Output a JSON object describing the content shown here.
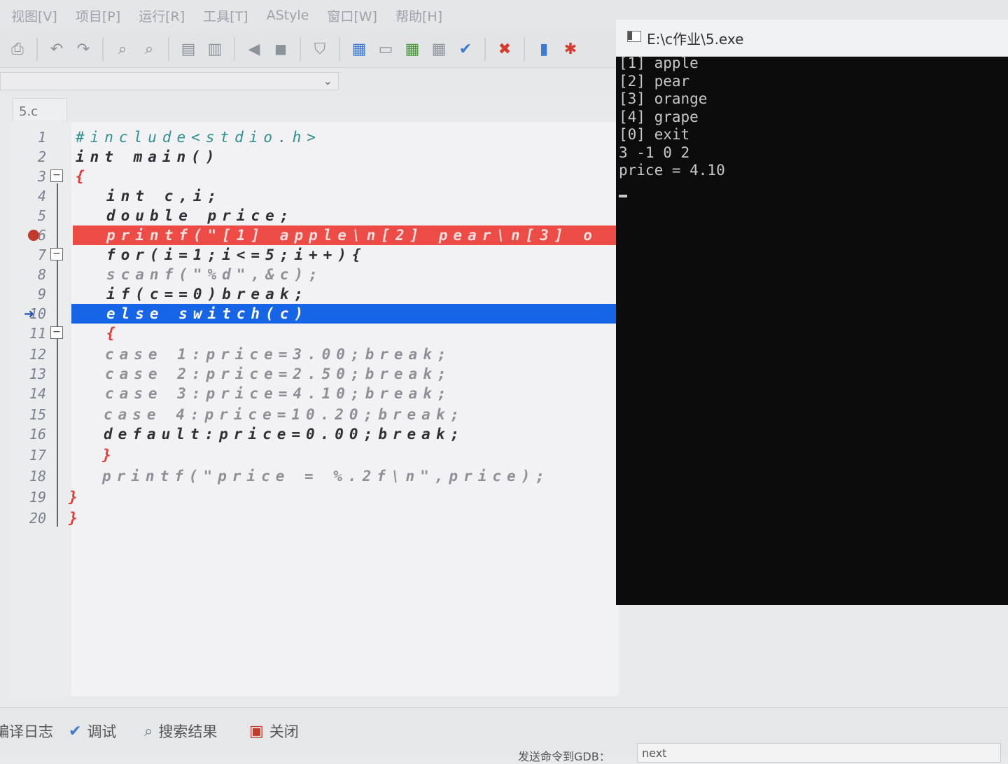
{
  "menu": [
    "视图[V]",
    "项目[P]",
    "运行[R]",
    "工具[T]",
    "AStyle",
    "窗口[W]",
    "帮助[H]"
  ],
  "editor": {
    "tab": "5.c",
    "lines": [
      {
        "n": "1",
        "text": "#include<stdio.h>"
      },
      {
        "n": "2",
        "text": "int main()"
      },
      {
        "n": "3",
        "text": "{"
      },
      {
        "n": "4",
        "text": "int c,i;"
      },
      {
        "n": "5",
        "text": "double price;"
      },
      {
        "n": "6",
        "text": "printf(\"[1] apple\\n[2] pear\\n[3] o"
      },
      {
        "n": "7",
        "text": "for(i=1;i<=5;i++){"
      },
      {
        "n": "8",
        "text": "scanf(\"%d\",&c);"
      },
      {
        "n": "9",
        "text": "if(c==0)break;"
      },
      {
        "n": "10",
        "text": "else switch(c)"
      },
      {
        "n": "11",
        "text": "{"
      },
      {
        "n": "12",
        "text": "case 1:price=3.00;break;"
      },
      {
        "n": "13",
        "text": "case 2:price=2.50;break;"
      },
      {
        "n": "14",
        "text": "case 3:price=4.10;break;"
      },
      {
        "n": "15",
        "text": "case 4:price=10.20;break;"
      },
      {
        "n": "16",
        "text": "default:price=0.00;break;"
      },
      {
        "n": "17",
        "text": "}"
      },
      {
        "n": "18",
        "text": "printf(\"price = %.2f\\n\",price);"
      },
      {
        "n": "19",
        "text": "}"
      },
      {
        "n": "20",
        "text": "}"
      }
    ]
  },
  "console": {
    "title": "E:\\c作业\\5.exe",
    "output": "[1] apple\n[2] pear\n[3] orange\n[4] grape\n[0] exit\n3 -1 0 2\nprice = 4.10"
  },
  "bottom": {
    "tabs": [
      "编译日志",
      "调试",
      "搜索结果",
      "关闭"
    ],
    "status_label": "发送命令到GDB：",
    "status_value": "next"
  },
  "colors": {
    "breakpoint_line": "#ec4b46",
    "current_line": "#1565e6",
    "console_bg": "#0c0c0c"
  }
}
